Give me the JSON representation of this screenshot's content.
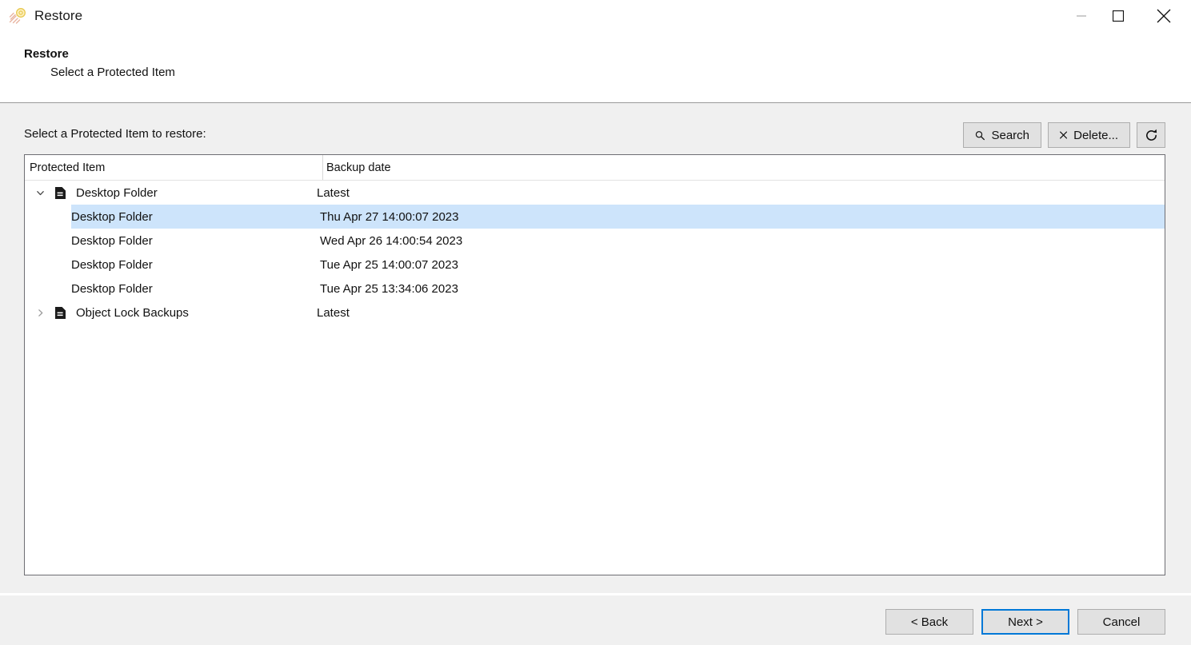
{
  "window": {
    "title": "Restore",
    "app_icon": "comet-logo-icon",
    "controls": {
      "minimize": "minimize-icon",
      "maximize": "maximize-icon",
      "close": "close-icon"
    }
  },
  "header": {
    "title": "Restore",
    "subtitle": "Select a Protected Item"
  },
  "body": {
    "instruction": "Select a Protected Item to restore:"
  },
  "toolbar": {
    "search_label": "Search",
    "delete_label": "Delete...",
    "refresh_label": ""
  },
  "list": {
    "columns": [
      "Protected Item",
      "Backup date"
    ],
    "rows": [
      {
        "name": "Desktop Folder",
        "date": "Latest",
        "type": "parent",
        "expanded": true,
        "selected": false
      },
      {
        "name": "Desktop Folder",
        "date": "Thu Apr 27 14:00:07 2023",
        "type": "child",
        "expanded": false,
        "selected": true
      },
      {
        "name": "Desktop Folder",
        "date": "Wed Apr 26 14:00:54 2023",
        "type": "child",
        "expanded": false,
        "selected": false
      },
      {
        "name": "Desktop Folder",
        "date": "Tue Apr 25 14:00:07 2023",
        "type": "child",
        "expanded": false,
        "selected": false
      },
      {
        "name": "Desktop Folder",
        "date": "Tue Apr 25 13:34:06 2023",
        "type": "child",
        "expanded": false,
        "selected": false
      },
      {
        "name": "Object Lock Backups",
        "date": "Latest",
        "type": "parent",
        "expanded": false,
        "selected": false
      }
    ]
  },
  "footer": {
    "back_label": "< Back",
    "next_label": "Next >",
    "cancel_label": "Cancel"
  },
  "colors": {
    "selection": "#cde4fb",
    "accent": "#0078d7",
    "body_bg": "#f0f0f0",
    "header_bg": "#ffffff",
    "button_bg": "#e1e1e1",
    "button_border": "#adadad",
    "list_border": "#6e6e73"
  }
}
